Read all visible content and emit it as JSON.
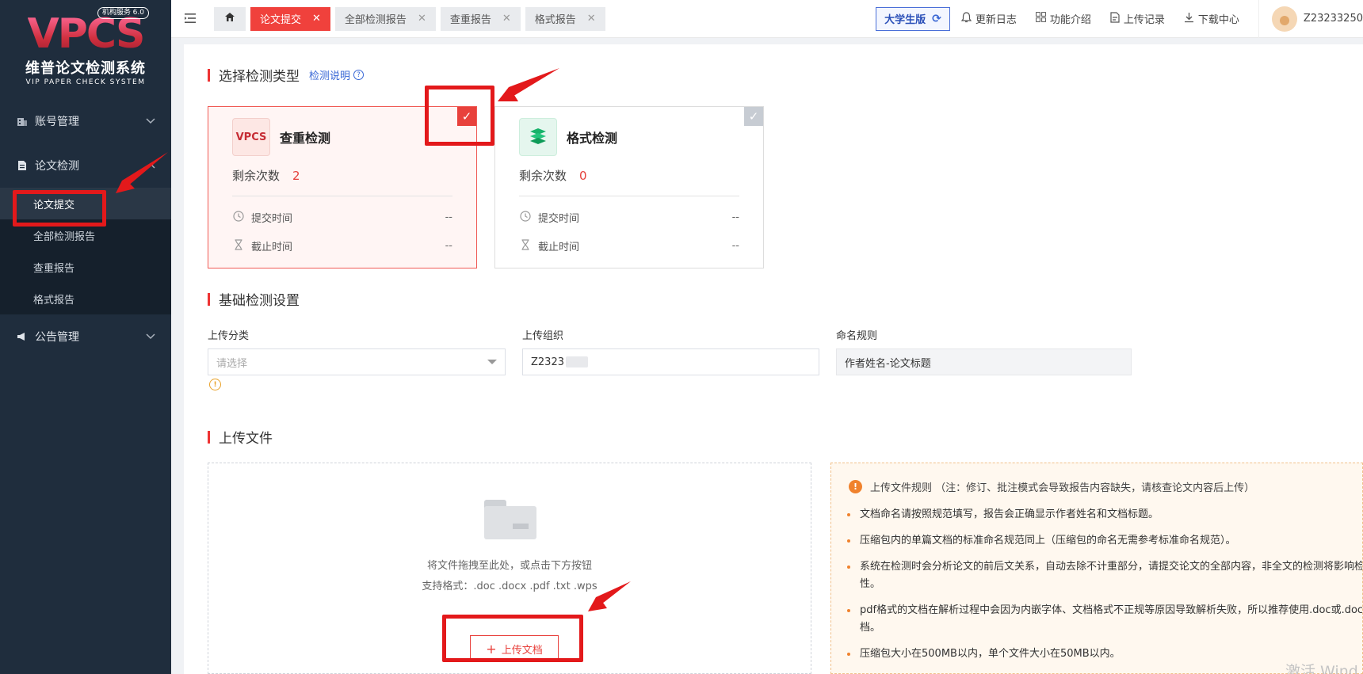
{
  "sidebar": {
    "logo": {
      "mark": "VPCS",
      "badge": "机构服务 6.0",
      "cn": "维普论文检测系统",
      "en": "VIP PAPER CHECK SYSTEM"
    },
    "menu": {
      "account": "账号管理",
      "paper_check": "论文检测",
      "sub_items": [
        "论文提交",
        "全部检测报告",
        "查重报告",
        "格式报告"
      ],
      "notice": "公告管理"
    }
  },
  "topbar": {
    "tabs": [
      "论文提交",
      "全部检测报告",
      "查重报告",
      "格式报告"
    ],
    "edition": "大学生版",
    "links": [
      "更新日志",
      "功能介绍",
      "上传记录",
      "下载中心"
    ],
    "username": "Z23233250"
  },
  "check_type": {
    "title": "选择检测类型",
    "help": "检测说明",
    "cards": [
      {
        "name": "查重检测",
        "logo_text": "VPCS",
        "remain_label": "剩余次数",
        "remain": "2",
        "submit_label": "提交时间",
        "submit_value": "--",
        "deadline_label": "截止时间",
        "deadline_value": "--",
        "selected": true
      },
      {
        "name": "格式检测",
        "remain_label": "剩余次数",
        "remain": "0",
        "submit_label": "提交时间",
        "submit_value": "--",
        "deadline_label": "截止时间",
        "deadline_value": "--",
        "selected": false
      }
    ]
  },
  "basic_settings": {
    "title": "基础检测设置",
    "upload_category_label": "上传分类",
    "upload_category_placeholder": "请选择",
    "upload_org_label": "上传组织",
    "upload_org_value": "Z2323",
    "naming_label": "命名规则",
    "naming_value": "作者姓名-论文标题"
  },
  "upload": {
    "title": "上传文件",
    "drop_hint": "将文件拖拽至此处，或点击下方按钮",
    "formats": "支持格式：.doc .docx .pdf .txt .wps",
    "button": "上传文档"
  },
  "rules": {
    "title": "上传文件规则  （注：修订、批注模式会导致报告内容缺失，请核查论文内容后上传）",
    "items": [
      "文档命名请按照规范填写，报告会正确显示作者姓名和文档标题。",
      "压缩包内的单篇文档的标准命名规范同上（压缩包的命名无需参考标准命名规范）。",
      "系统在检测时会分析论文的前后文关系，自动去除不计重部分，请提交论文的全部内容，非全文的检测将影响检测的准确性。",
      "pdf格式的文档在解析过程中会因为内嵌字体、文档格式不正规等原因导致解析失败，所以推荐使用.doc或.docx格式文档。",
      "压缩包大小在500MB以内，单个文件大小在50MB以内。"
    ]
  },
  "watermark": "激活 Wind",
  "colors": {
    "accent": "#e8413c",
    "sidebar": "#1f2d3d",
    "link": "#3867d6",
    "warn": "#f0822d"
  }
}
